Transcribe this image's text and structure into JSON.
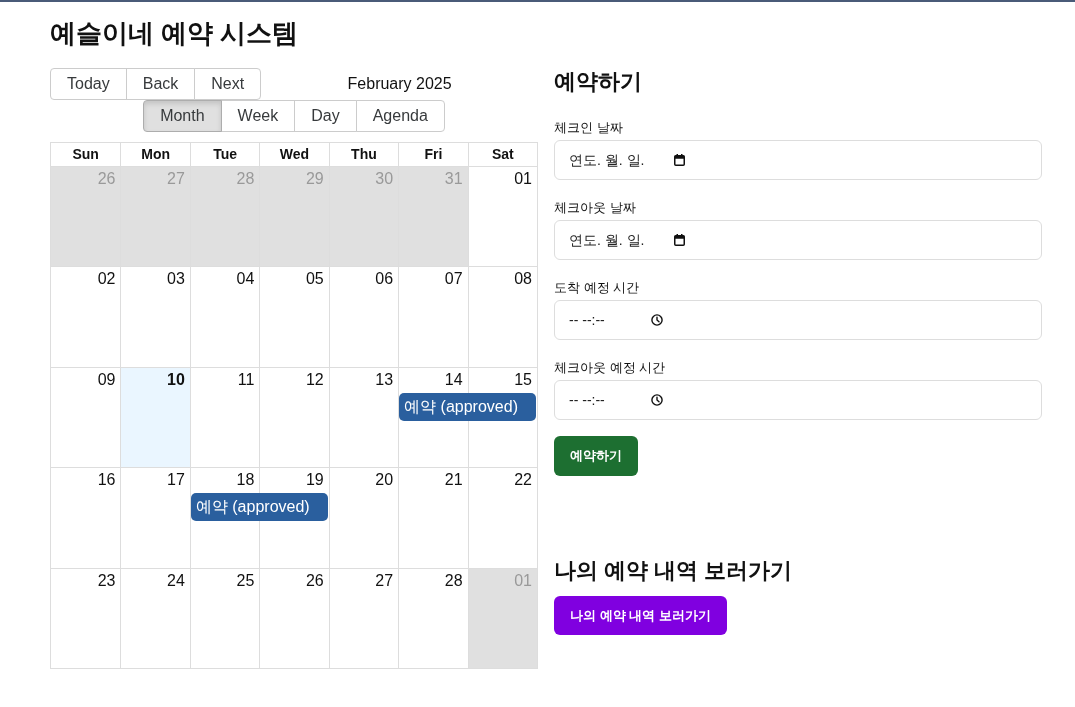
{
  "page": {
    "title": "예슬이네 예약 시스템"
  },
  "calendar": {
    "toolbar": {
      "nav_buttons": [
        "Today",
        "Back",
        "Next"
      ],
      "label": "February 2025",
      "views": [
        {
          "label": "Month",
          "selected": true
        },
        {
          "label": "Week",
          "selected": false
        },
        {
          "label": "Day",
          "selected": false
        },
        {
          "label": "Agenda",
          "selected": false
        }
      ]
    },
    "weekdays": [
      "Sun",
      "Mon",
      "Tue",
      "Wed",
      "Thu",
      "Fri",
      "Sat"
    ],
    "weeks": [
      {
        "days": [
          {
            "date": "26",
            "off_range": true,
            "today": false,
            "booked": false
          },
          {
            "date": "27",
            "off_range": true,
            "today": false,
            "booked": false
          },
          {
            "date": "28",
            "off_range": true,
            "today": false,
            "booked": false
          },
          {
            "date": "29",
            "off_range": true,
            "today": false,
            "booked": false
          },
          {
            "date": "30",
            "off_range": true,
            "today": false,
            "booked": false
          },
          {
            "date": "31",
            "off_range": true,
            "today": false,
            "booked": false
          },
          {
            "date": "01",
            "off_range": false,
            "today": false,
            "booked": false
          }
        ]
      },
      {
        "days": [
          {
            "date": "02",
            "off_range": false,
            "today": false,
            "booked": false
          },
          {
            "date": "03",
            "off_range": false,
            "today": false,
            "booked": false
          },
          {
            "date": "04",
            "off_range": false,
            "today": false,
            "booked": false
          },
          {
            "date": "05",
            "off_range": false,
            "today": false,
            "booked": false
          },
          {
            "date": "06",
            "off_range": false,
            "today": false,
            "booked": false
          },
          {
            "date": "07",
            "off_range": false,
            "today": false,
            "booked": false
          },
          {
            "date": "08",
            "off_range": false,
            "today": false,
            "booked": false
          }
        ]
      },
      {
        "days": [
          {
            "date": "09",
            "off_range": false,
            "today": false,
            "booked": false
          },
          {
            "date": "10",
            "off_range": false,
            "today": true,
            "booked": false
          },
          {
            "date": "11",
            "off_range": false,
            "today": false,
            "booked": false
          },
          {
            "date": "12",
            "off_range": false,
            "today": false,
            "booked": false
          },
          {
            "date": "13",
            "off_range": false,
            "today": false,
            "booked": false
          },
          {
            "date": "14",
            "off_range": false,
            "today": false,
            "booked": true,
            "event": "예약 (approved)"
          },
          {
            "date": "15",
            "off_range": false,
            "today": false,
            "booked": true
          }
        ]
      },
      {
        "days": [
          {
            "date": "16",
            "off_range": false,
            "today": false,
            "booked": false
          },
          {
            "date": "17",
            "off_range": false,
            "today": false,
            "booked": false
          },
          {
            "date": "18",
            "off_range": false,
            "today": false,
            "booked": true,
            "event": "예약 (approved)"
          },
          {
            "date": "19",
            "off_range": false,
            "today": false,
            "booked": true
          },
          {
            "date": "20",
            "off_range": false,
            "today": false,
            "booked": false
          },
          {
            "date": "21",
            "off_range": false,
            "today": false,
            "booked": false
          },
          {
            "date": "22",
            "off_range": false,
            "today": false,
            "booked": false
          }
        ]
      },
      {
        "days": [
          {
            "date": "23",
            "off_range": false,
            "today": false,
            "booked": false
          },
          {
            "date": "24",
            "off_range": false,
            "today": false,
            "booked": false
          },
          {
            "date": "25",
            "off_range": false,
            "today": false,
            "booked": false
          },
          {
            "date": "26",
            "off_range": false,
            "today": false,
            "booked": false
          },
          {
            "date": "27",
            "off_range": false,
            "today": false,
            "booked": false
          },
          {
            "date": "28",
            "off_range": false,
            "today": false,
            "booked": false
          },
          {
            "date": "01",
            "off_range": true,
            "today": false,
            "booked": false
          }
        ]
      }
    ]
  },
  "booking_form": {
    "title": "예약하기",
    "fields": [
      {
        "label": "체크인 날짜",
        "kind": "date",
        "placeholder": "연도. 월. 일."
      },
      {
        "label": "체크아웃 날짜",
        "kind": "date",
        "placeholder": "연도. 월. 일."
      },
      {
        "label": "도착 예정 시간",
        "kind": "time",
        "placeholder": "-- --:--"
      },
      {
        "label": "체크아웃 예정 시간",
        "kind": "time",
        "placeholder": "-- --:--"
      }
    ],
    "submit": "예약하기"
  },
  "history": {
    "title": "나의 예약 내역 보러가기",
    "button": "나의 예약 내역 보러가기"
  }
}
